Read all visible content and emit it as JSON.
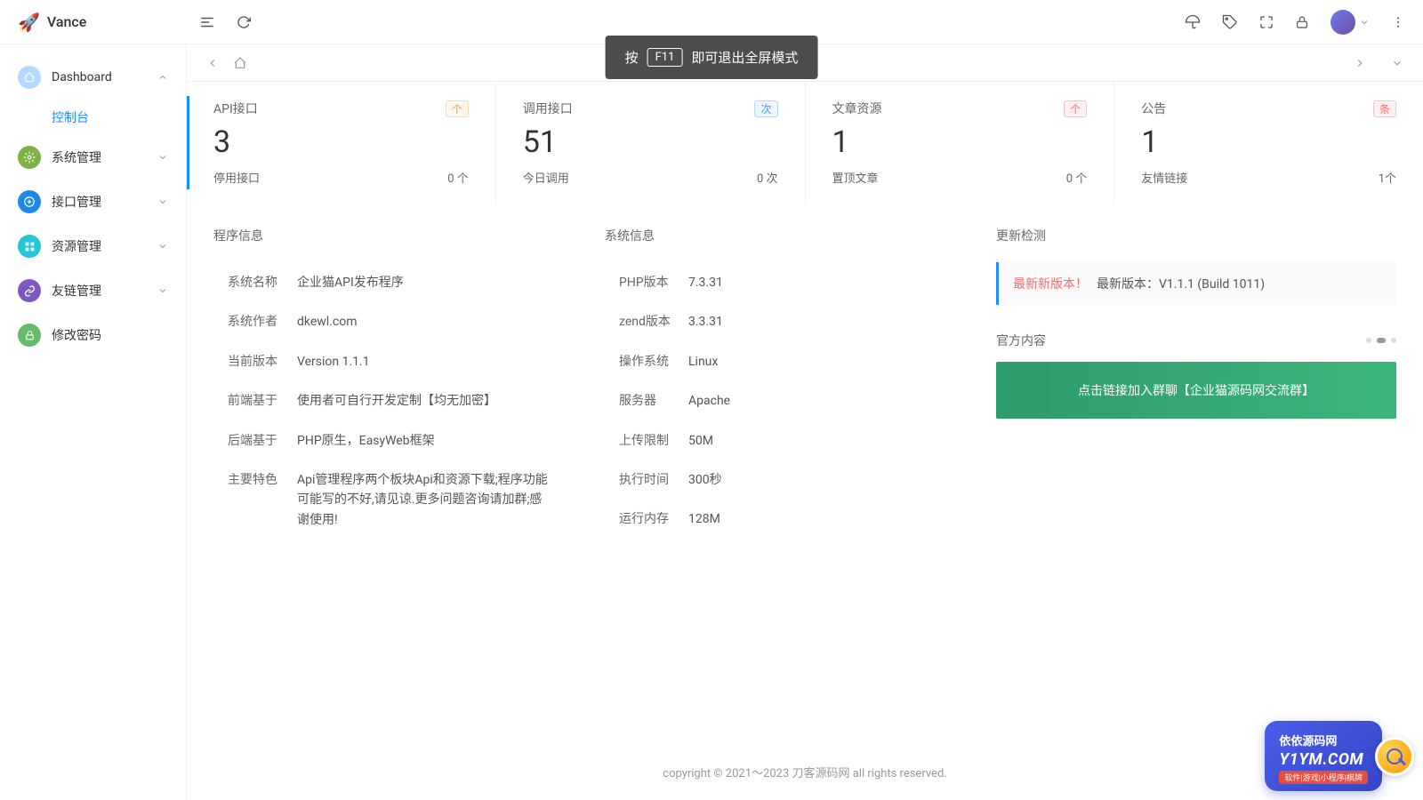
{
  "brand": "Vance",
  "toast": {
    "prefix": "按",
    "key": "F11",
    "suffix": "即可退出全屏模式"
  },
  "sidebar": {
    "items": [
      {
        "label": "Dashboard"
      },
      {
        "label": "系统管理"
      },
      {
        "label": "接口管理"
      },
      {
        "label": "资源管理"
      },
      {
        "label": "友链管理"
      },
      {
        "label": "修改密码"
      }
    ],
    "sub_console": "控制台"
  },
  "stats": [
    {
      "title": "API接口",
      "badge": "个",
      "value": "3",
      "bottom_label": "停用接口",
      "bottom_value": "0 个"
    },
    {
      "title": "调用接口",
      "badge": "次",
      "value": "51",
      "bottom_label": "今日调用",
      "bottom_value": "0 次"
    },
    {
      "title": "文章资源",
      "badge": "个",
      "value": "1",
      "bottom_label": "置顶文章",
      "bottom_value": "0 个"
    },
    {
      "title": "公告",
      "badge": "条",
      "value": "1",
      "bottom_label": "友情链接",
      "bottom_value": "1个"
    }
  ],
  "sections": {
    "program": "程序信息",
    "system": "系统信息",
    "update": "更新检测",
    "official": "官方内容"
  },
  "program_info": [
    {
      "label": "系统名称",
      "value": "企业猫API发布程序"
    },
    {
      "label": "系统作者",
      "value": "dkewl.com"
    },
    {
      "label": "当前版本",
      "value": "Version 1.1.1"
    },
    {
      "label": "前端基于",
      "value": "使用者可自行开发定制【均无加密】"
    },
    {
      "label": "后端基于",
      "value": "PHP原生，EasyWeb框架"
    },
    {
      "label": "主要特色",
      "value": "Api管理程序两个板块Api和资源下载;程序功能可能写的不好,请见谅.更多问题咨询请加群;感谢使用!"
    }
  ],
  "system_info": [
    {
      "label": "PHP版本",
      "value": "7.3.31"
    },
    {
      "label": "zend版本",
      "value": "3.3.31"
    },
    {
      "label": "操作系统",
      "value": "Linux"
    },
    {
      "label": "服务器",
      "value": "Apache"
    },
    {
      "label": "上传限制",
      "value": "50M"
    },
    {
      "label": "执行时间",
      "value": "300秒"
    },
    {
      "label": "运行内存",
      "value": "128M"
    }
  ],
  "update": {
    "alert": "最新新版本！",
    "text": "最新版本：V1.1.1 (Build 1011)"
  },
  "official_banner": "点击链接加入群聊【企业猫源码网交流群】",
  "footer": "copyright © 2021～2023 刀客源码网 all rights reserved.",
  "watermark": {
    "title": "依依源码网",
    "url": "Y1YM.COM",
    "sub": "软件|游戏|小程序|棋牌"
  }
}
